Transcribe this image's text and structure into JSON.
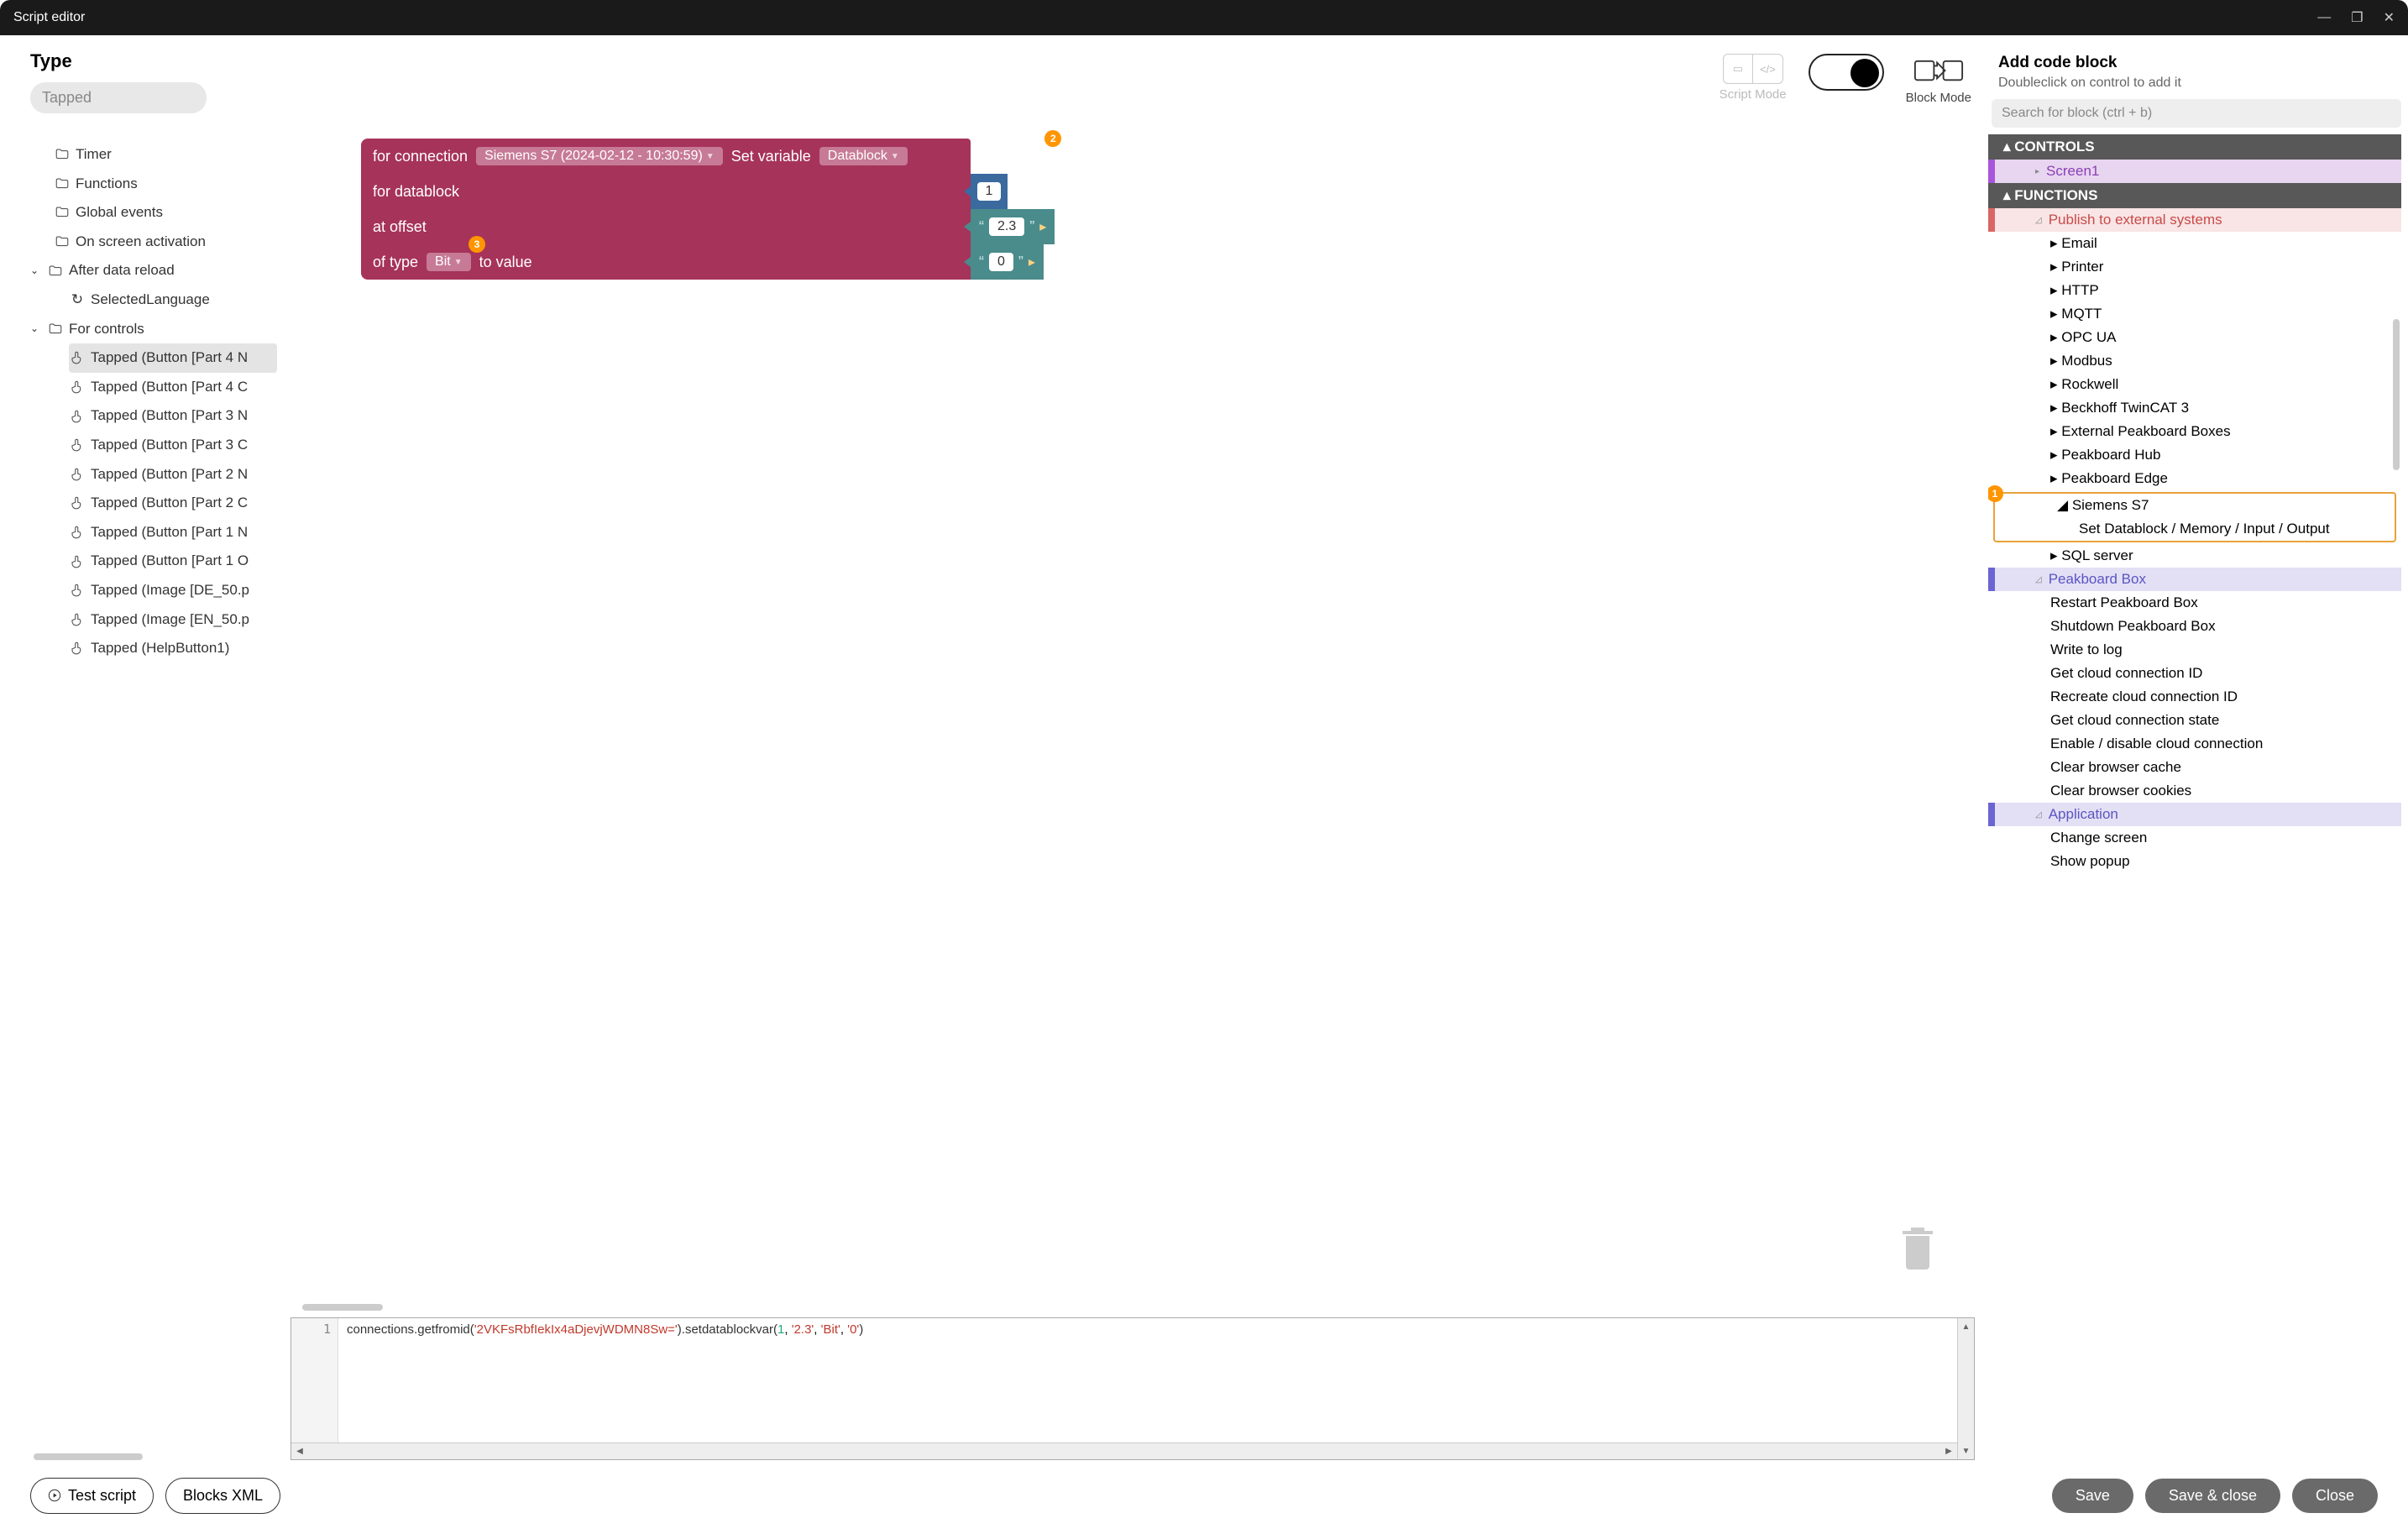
{
  "window": {
    "title": "Script editor"
  },
  "left": {
    "type_heading": "Type",
    "type_value": "Tapped",
    "tree": {
      "timer": "Timer",
      "functions": "Functions",
      "global_events": "Global events",
      "on_screen": "On screen activation",
      "after_reload": "After data reload",
      "selected_language": "SelectedLanguage",
      "for_controls": "For controls",
      "controls": [
        "Tapped (Button [Part 4 N",
        "Tapped (Button [Part 4 C",
        "Tapped (Button [Part 3 N",
        "Tapped (Button [Part 3 C",
        "Tapped (Button [Part 2 N",
        "Tapped (Button [Part 2 C",
        "Tapped (Button [Part 1 N",
        "Tapped (Button [Part 1 O",
        "Tapped (Image [DE_50.p",
        "Tapped (Image [EN_50.p",
        "Tapped (HelpButton1)"
      ]
    }
  },
  "center": {
    "script_mode": "Script Mode",
    "block_mode": "Block Mode",
    "block": {
      "for_connection": "for connection",
      "connection_value": "Siemens S7 (2024-02-12 - 10:30:59)",
      "set_variable": "Set variable",
      "variable_value": "Datablock",
      "for_datablock": "for datablock",
      "datablock_input": "1",
      "at_offset": "at offset",
      "offset_input": "2.3",
      "of_type": "of type",
      "type_value": "Bit",
      "to_value": "to value",
      "value_input": "0",
      "badge2": "2",
      "badge3": "3"
    },
    "code": {
      "line_no": "1",
      "text_a": "connections.getfromid(",
      "str1": "'2VKFsRbfIekIx4aDjevjWDMN8Sw='",
      "text_b": ").setdatablockvar(",
      "num1": "1",
      "sep": ", ",
      "str2": "'2.3'",
      "str3": "'Bit'",
      "str4": "'0'",
      "text_c": ")"
    }
  },
  "right": {
    "heading": "Add code block",
    "sub": "Doubleclick on control to add it",
    "search_placeholder": "Search for block (ctrl + b)",
    "controls_hdr": "CONTROLS",
    "screen1": "Screen1",
    "functions_hdr": "FUNCTIONS",
    "publish": "Publish to external systems",
    "pub_items": [
      "Email",
      "Printer",
      "HTTP",
      "MQTT",
      "OPC UA",
      "Modbus",
      "Rockwell",
      "Beckhoff TwinCAT 3",
      "External Peakboard Boxes",
      "Peakboard Hub",
      "Peakboard Edge"
    ],
    "siemens": "Siemens S7",
    "siemens_sub": "Set Datablock / Memory / Input / Output",
    "sql": "SQL server",
    "peakbox": "Peakboard Box",
    "peak_items": [
      "Restart Peakboard Box",
      "Shutdown Peakboard Box",
      "Write to log",
      "Get cloud connection ID",
      "Recreate cloud connection ID",
      "Get cloud connection state",
      "Enable / disable cloud connection",
      "Clear browser cache",
      "Clear browser cookies"
    ],
    "application": "Application",
    "app_items": [
      "Change screen",
      "Show popup"
    ],
    "highlight_badge": "1"
  },
  "footer": {
    "test": "Test script",
    "xml": "Blocks XML",
    "save": "Save",
    "save_close": "Save & close",
    "close": "Close"
  }
}
